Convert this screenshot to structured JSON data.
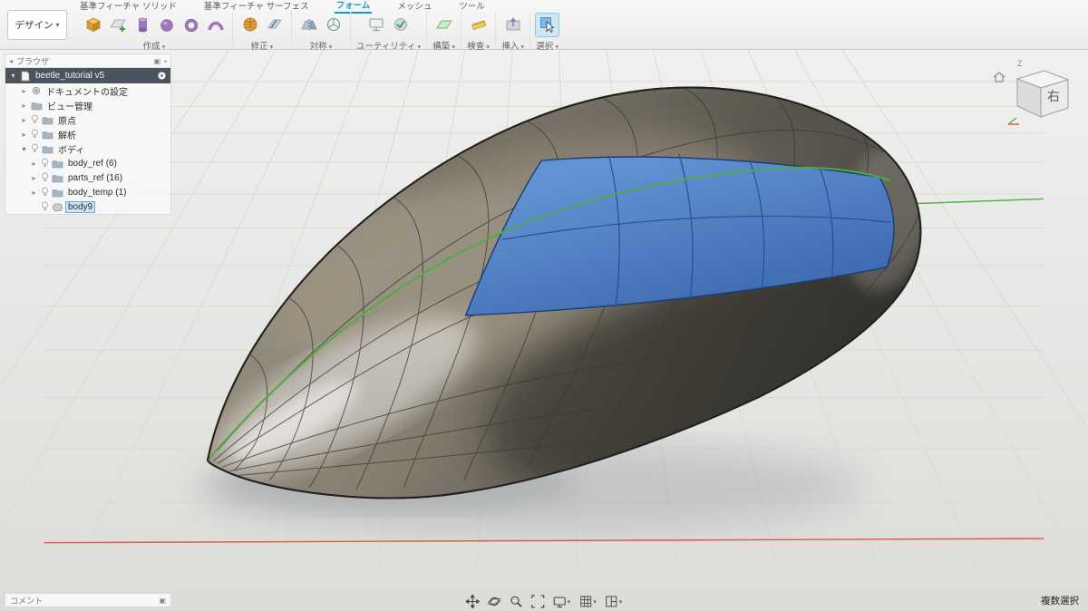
{
  "toolbar": {
    "design_label": "デザイン",
    "tabs": [
      {
        "label": "基準フィーチャ ソリッド"
      },
      {
        "label": "基準フィーチャ サーフェス"
      },
      {
        "label": "フォーム",
        "active": true
      },
      {
        "label": "メッシュ"
      },
      {
        "label": "ツール"
      }
    ],
    "groups": [
      {
        "label": "作成"
      },
      {
        "label": "修正"
      },
      {
        "label": "対称"
      },
      {
        "label": "ユーティリティ"
      },
      {
        "label": "構築"
      },
      {
        "label": "検査"
      },
      {
        "label": "挿入"
      },
      {
        "label": "選択"
      }
    ]
  },
  "browser": {
    "header": "ブラウザ",
    "root_label": "beetle_tutorial v5",
    "items": [
      {
        "label": "ドキュメントの設定"
      },
      {
        "label": "ビュー管理"
      },
      {
        "label": "原点"
      },
      {
        "label": "解析"
      },
      {
        "label": "ボディ"
      },
      {
        "label": "body_ref (6)"
      },
      {
        "label": "parts_ref (16)"
      },
      {
        "label": "body_temp (1)"
      },
      {
        "label": "body9"
      }
    ]
  },
  "viewcube": {
    "face": "右",
    "axis_z": "Z"
  },
  "footer": {
    "comment_label": "コメント",
    "status": "複数選択"
  },
  "colors": {
    "accent": "#1696d5",
    "selection_blue": "#4d7fc4",
    "model_tan": "#8d8678",
    "centerline_green": "#4fae3f",
    "axis_red": "#e05a4e"
  }
}
